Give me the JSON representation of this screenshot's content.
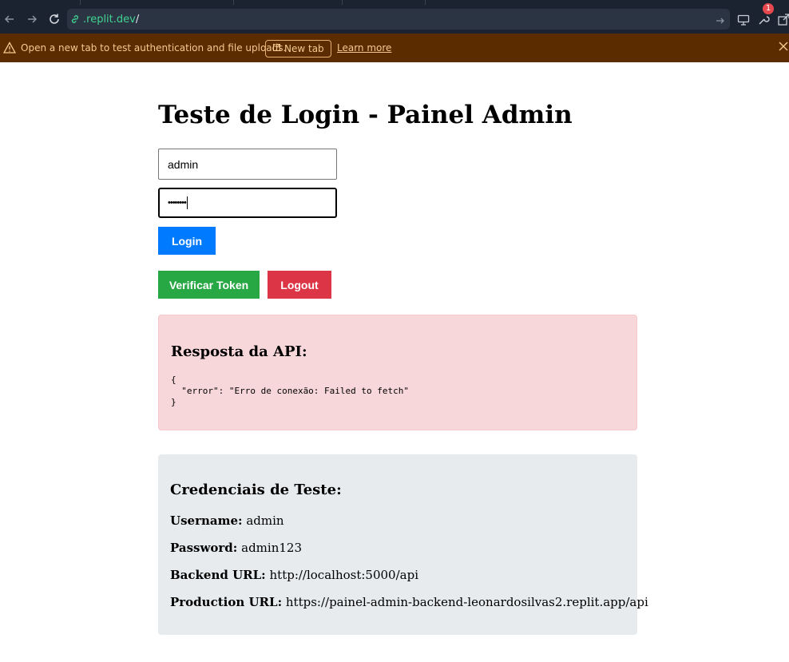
{
  "browser": {
    "url_host": ".replit.dev",
    "url_path": "/",
    "badge_count": "1"
  },
  "banner": {
    "message": "Open a new tab to test authentication and file uploads.",
    "new_tab_label": "New tab",
    "learn_more_label": "Learn more"
  },
  "page": {
    "title": "Teste de Login - Painel Admin",
    "username_value": "admin",
    "password_mask": "••••••••",
    "login_button": "Login",
    "verify_button": "Verificar Token",
    "logout_button": "Logout"
  },
  "response": {
    "heading": "Resposta da API:",
    "body": "{\n  \"error\": \"Erro de conexão: Failed to fetch\"\n}"
  },
  "credentials": {
    "heading": "Credenciais de Teste:",
    "items": [
      {
        "label": "Username:",
        "value": "admin"
      },
      {
        "label": "Password:",
        "value": "admin123"
      },
      {
        "label": "Backend URL:",
        "value": "http://localhost:5000/api"
      },
      {
        "label": "Production URL:",
        "value": "https://painel-admin-backend-leonardosilvas2.replit.app/api"
      }
    ]
  },
  "colors": {
    "primary": "#007bff",
    "success": "#28a745",
    "danger": "#dc3545",
    "error_bg": "#f8d7da",
    "info_bg": "#e8ebee",
    "banner_bg": "#5a2c00",
    "url_green": "#42d392"
  }
}
